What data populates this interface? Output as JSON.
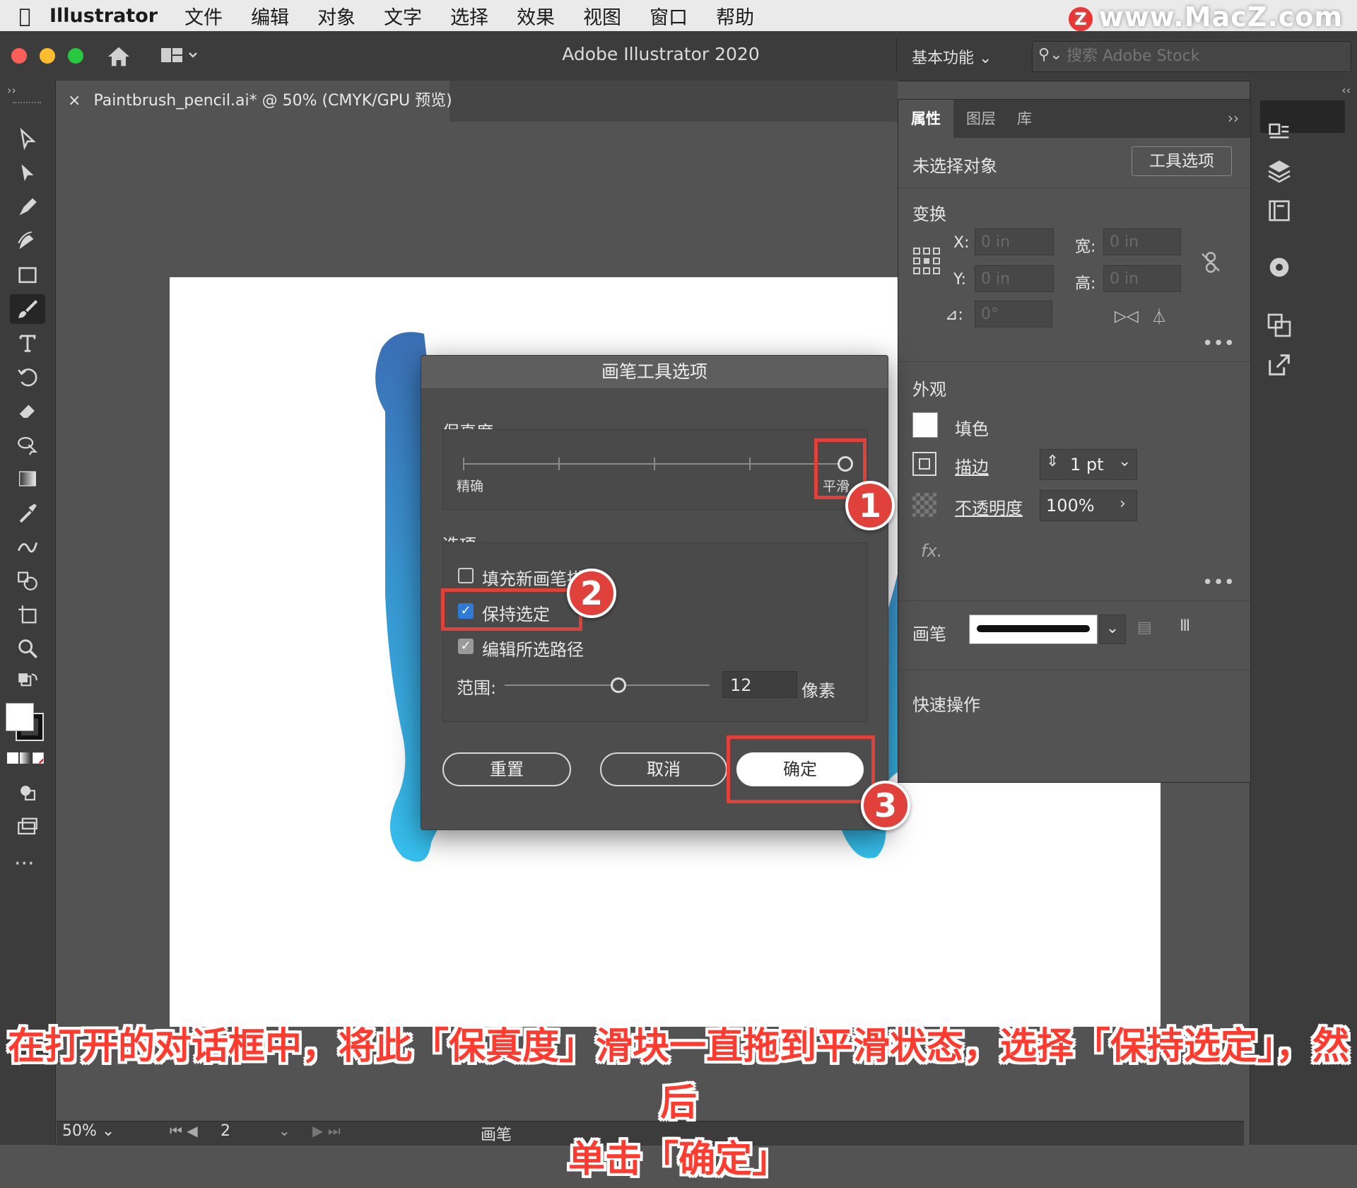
{
  "menubar": {
    "app": "Illustrator",
    "items": [
      "文件",
      "编辑",
      "对象",
      "文字",
      "选择",
      "效果",
      "视图",
      "窗口",
      "帮助"
    ],
    "watermark": "www.MacZ.com",
    "watermark_badge": "Z"
  },
  "titlebar": {
    "title": "Adobe Illustrator 2020",
    "workspace": "基本功能",
    "stock_placeholder": "搜索 Adobe Stock"
  },
  "document": {
    "tab_title": "Paintbrush_pencil.ai* @ 50% (CMYK/GPU 预览)",
    "close_glyph": "×"
  },
  "properties": {
    "tabs": [
      "属性",
      "图层",
      "库"
    ],
    "no_selection": "未选择对象",
    "tool_options_button": "工具选项",
    "transform": {
      "heading": "变换",
      "x_label": "X:",
      "x_value": "0 in",
      "y_label": "Y:",
      "y_value": "0 in",
      "w_label": "宽:",
      "w_value": "0 in",
      "h_label": "高:",
      "h_value": "0 in",
      "angle_label": "⊿:",
      "angle_value": "0°"
    },
    "appearance": {
      "heading": "外观",
      "fill": "填色",
      "stroke": "描边",
      "stroke_weight": "1 pt",
      "opacity": "不透明度",
      "opacity_value": "100%",
      "fx": "fx."
    },
    "brush_label": "画笔",
    "quick_actions": "快速操作"
  },
  "dialog": {
    "title": "画笔工具选项",
    "fidelity_heading": "保真度",
    "fidelity_left": "精确",
    "fidelity_right": "平滑",
    "fidelity_value": 1.0,
    "options_heading": "选项",
    "fill_new": "填充新画笔描边",
    "keep_selected": "保持选定",
    "edit_selected": "编辑所选路径",
    "range_label": "范围:",
    "range_value": "12",
    "range_unit": "像素",
    "reset": "重置",
    "cancel": "取消",
    "ok": "确定",
    "checkbox_states": {
      "fill_new": false,
      "keep_selected": true,
      "edit_selected": true
    }
  },
  "annotations": {
    "badge1": "1",
    "badge2": "2",
    "badge3": "3",
    "caption_line1": "在打开的对话框中，将此「保真度」滑块一直拖到平滑状态，选择「保持选定」，然后",
    "caption_line2": "单击「确定」"
  },
  "status": {
    "zoom": "50%",
    "page": "2",
    "tool": "画笔"
  },
  "colors": {
    "accent_red": "#e0413a",
    "artwork_top": "#3b6fb5",
    "artwork_bottom": "#35c0ee",
    "checkbox_blue": "#2e7ad6"
  }
}
